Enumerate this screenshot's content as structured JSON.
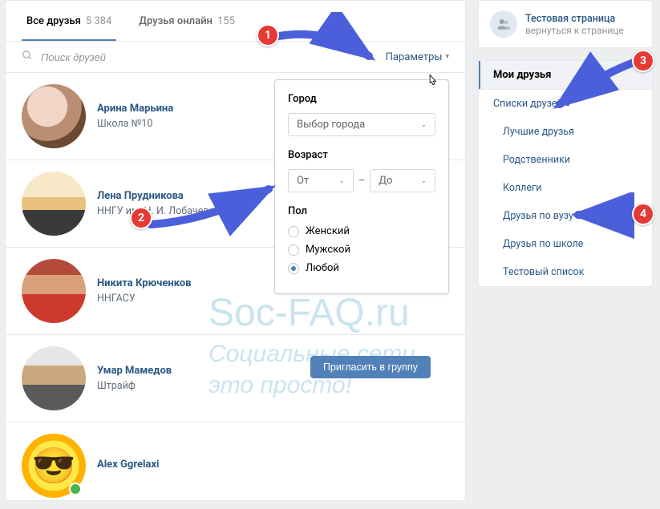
{
  "tabs": {
    "all_label": "Все друзья",
    "all_count": "5 384",
    "online_label": "Друзья онлайн",
    "online_count": "155"
  },
  "search": {
    "placeholder": "Поиск друзей",
    "params_label": "Параметры"
  },
  "friends": [
    {
      "name": "Арина Марьина",
      "sub": "Школа №10"
    },
    {
      "name": "Лена Прудникова",
      "sub": "ННГУ им. Н. И. Лобачевского"
    },
    {
      "name": "Никита Крюченков",
      "sub": "ННГАСУ"
    },
    {
      "name": "Умар Мамедов",
      "sub": "Штрайф"
    },
    {
      "name": "Alex Ggrelaxi",
      "sub": ""
    }
  ],
  "popover": {
    "city_label": "Город",
    "city_select": "Выбор города",
    "age_label": "Возраст",
    "age_from": "От",
    "age_to": "До",
    "gender_label": "Пол",
    "gender_female": "Женский",
    "gender_male": "Мужской",
    "gender_any": "Любой"
  },
  "sidebar": {
    "profile_name": "Тестовая страница",
    "profile_return": "вернуться к странице",
    "menu_friends": "Мои друзья",
    "lists_header": "Списки друзей",
    "lists": [
      "Лучшие друзья",
      "Родственники",
      "Коллеги",
      "Друзья по вузу",
      "Друзья по школе",
      "Тестовый список"
    ]
  },
  "invite_label": "Пригласить в группу",
  "annotations": [
    "1",
    "2",
    "3",
    "4"
  ],
  "watermark": {
    "line1": "Soc-FAQ.ru",
    "line2": "Социальные сети",
    "line3": "это просто!"
  }
}
